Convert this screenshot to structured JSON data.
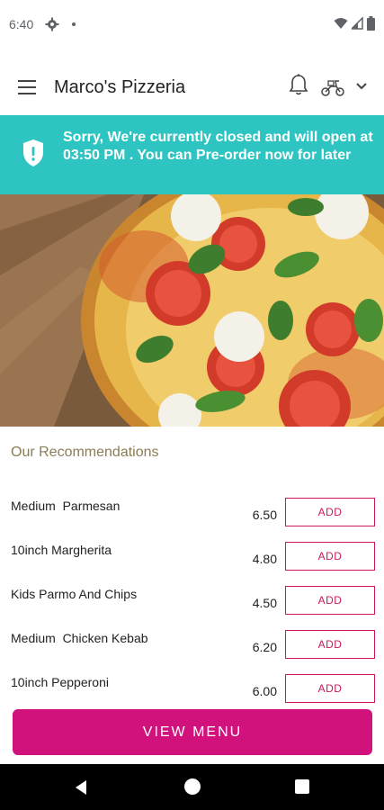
{
  "status_bar": {
    "time": "6:40"
  },
  "app_bar": {
    "title": "Marco's Pizzeria"
  },
  "banner": {
    "message": "Sorry, We're currently closed and will open at 03:50 PM . You can Pre-order now for later",
    "color": "#2ec4c2"
  },
  "recommendations": {
    "title": "Our Recommendations",
    "add_label": "ADD",
    "items": [
      {
        "name": "Medium  Parmesan",
        "price": "6.50"
      },
      {
        "name": "10inch Margherita",
        "price": "4.80"
      },
      {
        "name": "Kids Parmo And Chips",
        "price": "4.50"
      },
      {
        "name": "Medium  Chicken Kebab",
        "price": "6.20"
      },
      {
        "name": "10inch Pepperoni",
        "price": "6.00"
      }
    ]
  },
  "view_menu": {
    "label": "VIEW MENU",
    "color": "#d1127d"
  },
  "colors": {
    "accent": "#c9185f",
    "recommendation_title": "#8a7d55"
  }
}
